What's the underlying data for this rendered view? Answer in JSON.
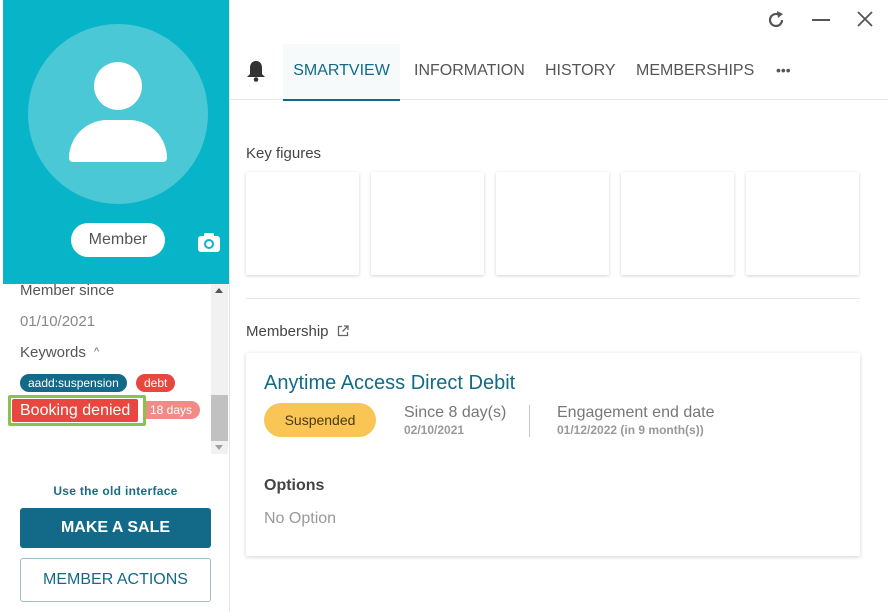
{
  "window": {
    "refresh_icon": "refresh-icon",
    "minimize_icon": "minimize-icon",
    "close_icon": "close-icon"
  },
  "profile": {
    "role_label": "Member",
    "member_since_label": "Member since",
    "member_since_value": "01/10/2021",
    "keywords_label": "Keywords",
    "tags": [
      {
        "label": "aadd:suspension",
        "color": "#136a88"
      },
      {
        "label": "debt",
        "color": "#e8473f"
      },
      {
        "label": "Booking denied",
        "color": "#e8473f"
      },
      {
        "label": "18 days",
        "color": "#f08b86"
      }
    ]
  },
  "sidebar": {
    "old_interface_link": "Use the old interface",
    "make_sale_label": "MAKE A SALE",
    "member_actions_label": "MEMBER ACTIONS"
  },
  "tabs": [
    {
      "label": "SMARTVIEW",
      "active": true
    },
    {
      "label": "INFORMATION",
      "active": false
    },
    {
      "label": "HISTORY",
      "active": false
    },
    {
      "label": "MEMBERSHIPS",
      "active": false
    },
    {
      "label": "•••",
      "active": false
    }
  ],
  "key_figures": {
    "title": "Key figures"
  },
  "membership": {
    "title": "Membership",
    "name": "Anytime Access Direct Debit",
    "status": "Suspended",
    "since_label": "Since 8 day(s)",
    "since_date": "02/10/2021",
    "engagement_label": "Engagement end date",
    "engagement_date": "01/12/2022 (in 9 month(s))",
    "options_label": "Options",
    "options_value": "No Option"
  },
  "colors": {
    "accent": "#136a88",
    "hero": "#08b5c8",
    "status_suspended": "#f9c554",
    "highlight": "#8bc34a"
  }
}
